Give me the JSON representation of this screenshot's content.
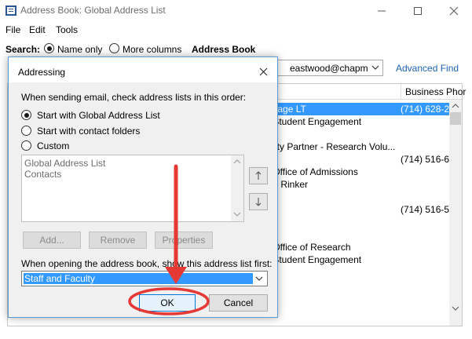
{
  "window": {
    "title": "Address Book: Global Address List",
    "menu": [
      "File",
      "Edit",
      "Tools"
    ]
  },
  "search": {
    "label": "Search:",
    "name_only": "Name only",
    "more_columns": "More columns",
    "address_book_label": "Address Book",
    "email_value": "eastwood@chapman",
    "advanced_find": "Advanced Find"
  },
  "results": {
    "column_business": "Business Phor",
    "rows": [
      {
        "name": "ngage LT",
        "phone": "(714) 628-27",
        "selected": true
      },
      {
        "name": "- Student Engagement",
        "phone": ""
      },
      {
        "name": "",
        "phone": ""
      },
      {
        "name": "rsity Partner - Research Volu...",
        "phone": ""
      },
      {
        "name": "",
        "phone": "(714) 516-61"
      },
      {
        "name": "- Office of Admissions",
        "phone": ""
      },
      {
        "name": "for Rinker",
        "phone": ""
      },
      {
        "name": "",
        "phone": ""
      },
      {
        "name": "",
        "phone": "(714) 516-57"
      },
      {
        "name": "",
        "phone": ""
      },
      {
        "name": "",
        "phone": ""
      },
      {
        "name": "- Office of Research",
        "phone": ""
      },
      {
        "name": "- Student Engagement",
        "phone": ""
      }
    ]
  },
  "dialog": {
    "title": "Addressing",
    "instruction": "When sending email, check address lists in this order:",
    "options": [
      {
        "label": "Start with Global Address List",
        "checked": true
      },
      {
        "label": "Start with contact folders",
        "checked": false
      },
      {
        "label": "Custom",
        "checked": false
      }
    ],
    "address_lists": [
      "Global Address List",
      "Contacts"
    ],
    "buttons": {
      "add": "Add...",
      "remove": "Remove",
      "properties": "Properties",
      "ok": "OK",
      "cancel": "Cancel"
    },
    "open_label": "When opening the address book, show this address list first:",
    "open_list_value": "Staff and Faculty"
  },
  "colors": {
    "selection": "#3399ff",
    "link": "#1d64b5",
    "annotation": "#e53935"
  }
}
